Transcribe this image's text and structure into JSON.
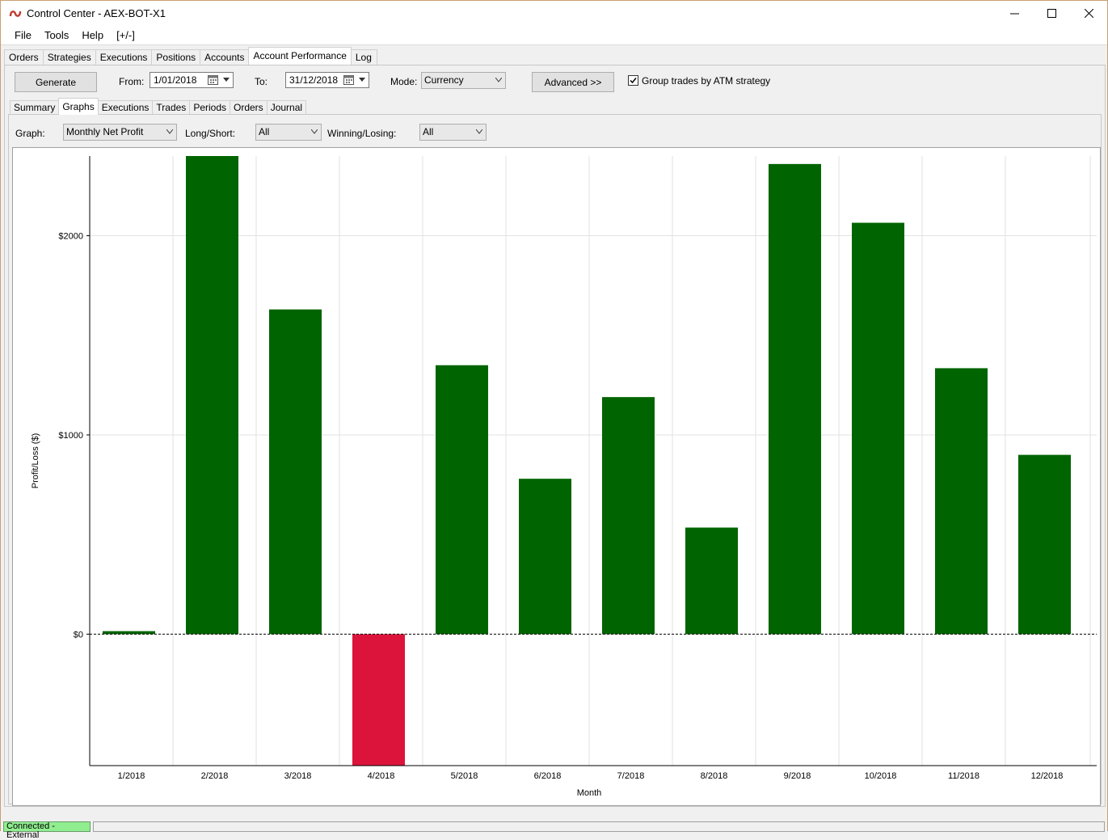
{
  "window": {
    "title": "Control Center - AEX-BOT-X1"
  },
  "menu": [
    "File",
    "Tools",
    "Help",
    "[+/-]"
  ],
  "main_tabs": [
    {
      "label": "Orders",
      "active": false
    },
    {
      "label": "Strategies",
      "active": false
    },
    {
      "label": "Executions",
      "active": false
    },
    {
      "label": "Positions",
      "active": false
    },
    {
      "label": "Accounts",
      "active": false
    },
    {
      "label": "Account Performance",
      "active": true
    },
    {
      "label": "Log",
      "active": false
    }
  ],
  "toolbar": {
    "generate_label": "Generate",
    "from_label": "From:",
    "from_value": "1/01/2018",
    "to_label": "To:",
    "to_value": "31/12/2018",
    "mode_label": "Mode:",
    "mode_value": "Currency",
    "advanced_label": "Advanced >>",
    "group_label": "Group trades by ATM strategy",
    "group_checked": true
  },
  "sub_tabs": [
    {
      "label": "Summary",
      "active": false
    },
    {
      "label": "Graphs",
      "active": true
    },
    {
      "label": "Executions",
      "active": false
    },
    {
      "label": "Trades",
      "active": false
    },
    {
      "label": "Periods",
      "active": false
    },
    {
      "label": "Orders",
      "active": false
    },
    {
      "label": "Journal",
      "active": false
    }
  ],
  "filters": {
    "graph_label": "Graph:",
    "graph_value": "Monthly Net Profit",
    "longshort_label": "Long/Short:",
    "longshort_value": "All",
    "winlose_label": "Winning/Losing:",
    "winlose_value": "All"
  },
  "chart_data": {
    "type": "bar",
    "xlabel": "Month",
    "ylabel": "Profit/Loss ($)",
    "categories": [
      "1/2018",
      "2/2018",
      "3/2018",
      "4/2018",
      "5/2018",
      "6/2018",
      "7/2018",
      "8/2018",
      "9/2018",
      "10/2018",
      "11/2018",
      "12/2018"
    ],
    "values": [
      15,
      2400,
      1630,
      -660,
      1350,
      780,
      1190,
      535,
      2360,
      2065,
      1335,
      900
    ],
    "ylim": [
      -660,
      2400
    ],
    "yticks": [
      0,
      1000,
      2000
    ],
    "ytick_labels": [
      "$0",
      "$1000",
      "$2000"
    ],
    "positive_color": "#006400",
    "negative_color": "#dc143c",
    "grid": true,
    "zero_line": "dashed"
  },
  "status": {
    "connection": "Connected - External"
  }
}
